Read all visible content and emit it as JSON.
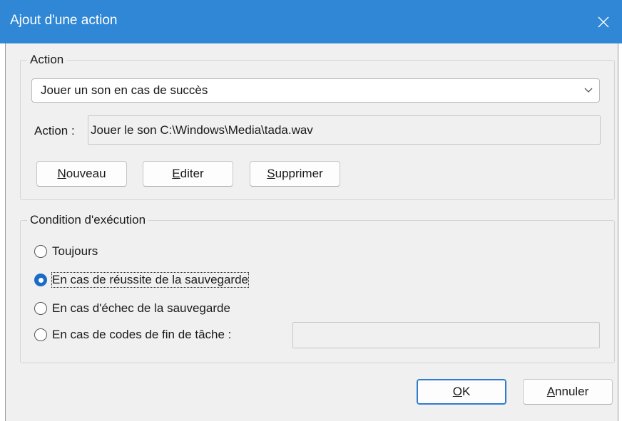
{
  "window": {
    "title": "Ajout d'une action",
    "close_icon": "close-icon"
  },
  "action_group": {
    "legend": "Action",
    "select": {
      "value": "Jouer un son en cas de succès",
      "chevron_icon": "chevron-down-icon"
    },
    "action_label": "Action :",
    "action_value": "Jouer le son C:\\Windows\\Media\\tada.wav",
    "buttons": {
      "new": {
        "accel": "N",
        "rest": "ouveau"
      },
      "edit": {
        "accel": "E",
        "rest": "diter"
      },
      "delete": {
        "accel": "S",
        "rest": "upprimer"
      }
    }
  },
  "condition_group": {
    "legend": "Condition d'exécution",
    "options": [
      {
        "label": "Toujours",
        "checked": false
      },
      {
        "label": "En cas de réussite de la sauvegarde",
        "checked": true
      },
      {
        "label": "En cas d'échec de la sauvegarde",
        "checked": false
      },
      {
        "label": "En cas de codes de fin de tâche :",
        "checked": false
      }
    ],
    "codes_value": ""
  },
  "footer": {
    "ok": {
      "accel": "O",
      "rest": "K"
    },
    "cancel": {
      "accel": "A",
      "rest": "nnuler"
    }
  },
  "colors": {
    "titlebar": "#2f87d6",
    "accent": "#1a6cc7",
    "background": "#f0f0f0"
  }
}
